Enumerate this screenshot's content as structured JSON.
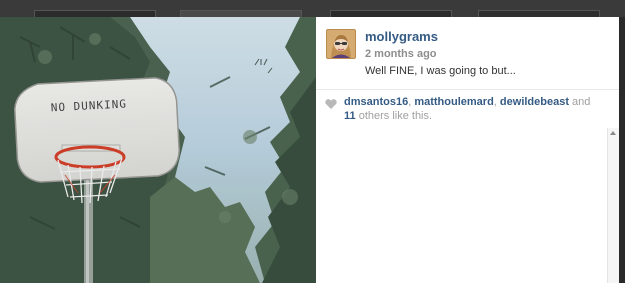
{
  "post": {
    "username": "mollygrams",
    "timestamp": "2 months ago",
    "caption": "Well FINE, I was going to but..."
  },
  "photo": {
    "sign_text": "NO DUNKING"
  },
  "likes": {
    "users": [
      "dmsantos16",
      "matthoulemard",
      "dewildebeast"
    ],
    "sep1": ", ",
    "sep2": ", ",
    "and_text": " and ",
    "count": "11",
    "suffix": " others like this."
  },
  "icons": {
    "heart": "heart-icon",
    "scroll_up": "scroll-up-arrow-icon"
  },
  "colors": {
    "username_link": "#355b84",
    "meta_gray": "#8d8d8d"
  }
}
